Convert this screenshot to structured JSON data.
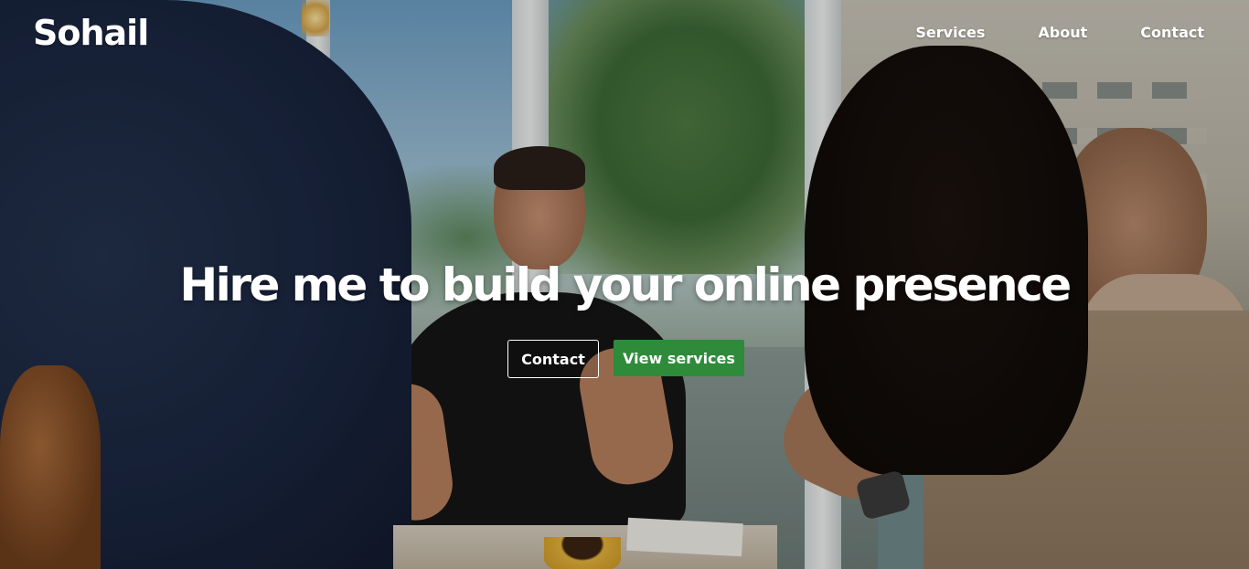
{
  "brand": {
    "logo_text": "Sohail"
  },
  "nav": {
    "items": [
      {
        "label": "Services"
      },
      {
        "label": "About"
      },
      {
        "label": "Contact"
      }
    ]
  },
  "hero": {
    "headline": "Hire me to build your online presence",
    "buttons": {
      "contact_label": "Contact",
      "services_label": "View services"
    }
  },
  "colors": {
    "primary_button": "#2e8b3a",
    "text": "#ffffff"
  }
}
